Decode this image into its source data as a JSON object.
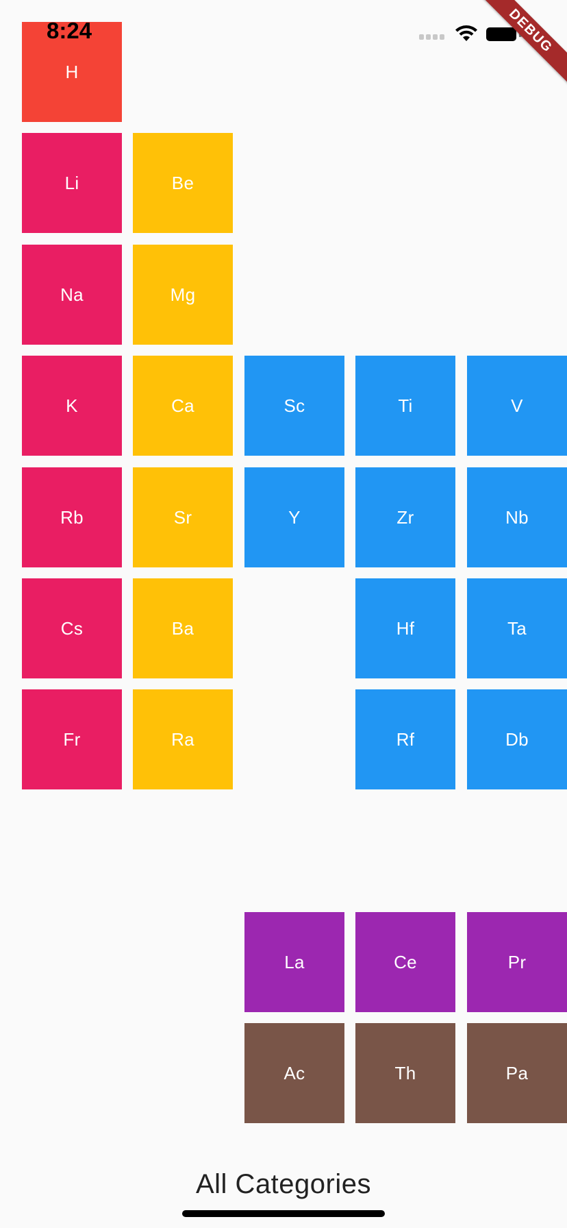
{
  "status_bar": {
    "time": "8:24"
  },
  "debug_banner": {
    "label": "DEBUG"
  },
  "colors": {
    "alkali_metal": "#e91e63",
    "alkaline_earth_metal": "#ffc107",
    "transition_metal": "#2196f3",
    "lanthanide": "#9c27b0",
    "actinide": "#795548",
    "hydrogen": "#f44336"
  },
  "elements": {
    "H": "H",
    "Li": "Li",
    "Be": "Be",
    "Na": "Na",
    "Mg": "Mg",
    "K": "K",
    "Ca": "Ca",
    "Sc": "Sc",
    "Ti": "Ti",
    "V": "V",
    "Rb": "Rb",
    "Sr": "Sr",
    "Y": "Y",
    "Zr": "Zr",
    "Nb": "Nb",
    "Cs": "Cs",
    "Ba": "Ba",
    "Hf": "Hf",
    "Ta": "Ta",
    "Fr": "Fr",
    "Ra": "Ra",
    "Rf": "Rf",
    "Db": "Db",
    "La": "La",
    "Ce": "Ce",
    "Pr": "Pr",
    "Ac": "Ac",
    "Th": "Th",
    "Pa": "Pa"
  },
  "footer": {
    "title": "All Categories"
  }
}
